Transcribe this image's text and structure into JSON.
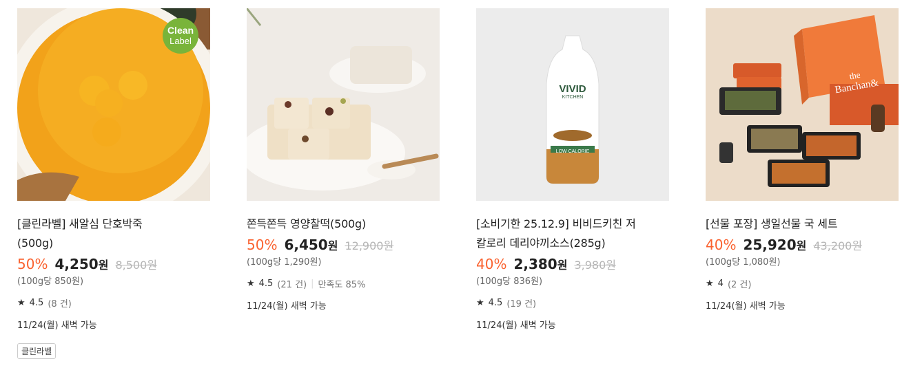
{
  "products": [
    {
      "image_alt": "",
      "title_line1": "[클린라벨] 새알심 단호박죽",
      "title_line2": "(500g)",
      "discount": "50%",
      "price": "4,250",
      "currency": "원",
      "original_price": "8,500원",
      "unit_price": "(100g당 850원)",
      "rating": "4.5",
      "review_count": "(8 건)",
      "delivery": "11/24(월) 새벽 가능",
      "tag": "클린라벨",
      "badge_line1": "Clean",
      "badge_line2": "Label"
    },
    {
      "title_line1": "쫀득쫀득 영양찰떡(500g)",
      "discount": "50%",
      "price": "6,450",
      "currency": "원",
      "original_price": "12,900원",
      "unit_price": "(100g당 1,290원)",
      "rating": "4.5",
      "review_count": "(21 건)",
      "satisfaction": "만족도 85%",
      "delivery": "11/24(월) 새벽 가능"
    },
    {
      "title_line1": "[소비기한 25.12.9] 비비드키친 저",
      "title_line2": "칼로리 데리야끼소스(285g)",
      "discount": "40%",
      "price": "2,380",
      "currency": "원",
      "original_price": "3,980원",
      "unit_price": "(100g당 836원)",
      "rating": "4.5",
      "review_count": "(19 건)",
      "delivery": "11/24(월) 새벽 가능",
      "bottle_brand": "VIVID",
      "bottle_sub": "KITCHEN",
      "bottle_label": "LOW CALORIE"
    },
    {
      "title_line1": "[선물 포장] 생일선물 국 세트",
      "discount": "40%",
      "price": "25,920",
      "currency": "원",
      "original_price": "43,200원",
      "unit_price": "(100g당 1,080원)",
      "rating": "4",
      "review_count": "(2 건)",
      "delivery": "11/24(월) 새벽 가능",
      "box_text_line1": "the",
      "box_text_line2": "Banchan&"
    }
  ],
  "icons": {
    "star": "star-icon"
  },
  "colors": {
    "discount": "#fa622f",
    "strike": "#b5b5b5"
  }
}
